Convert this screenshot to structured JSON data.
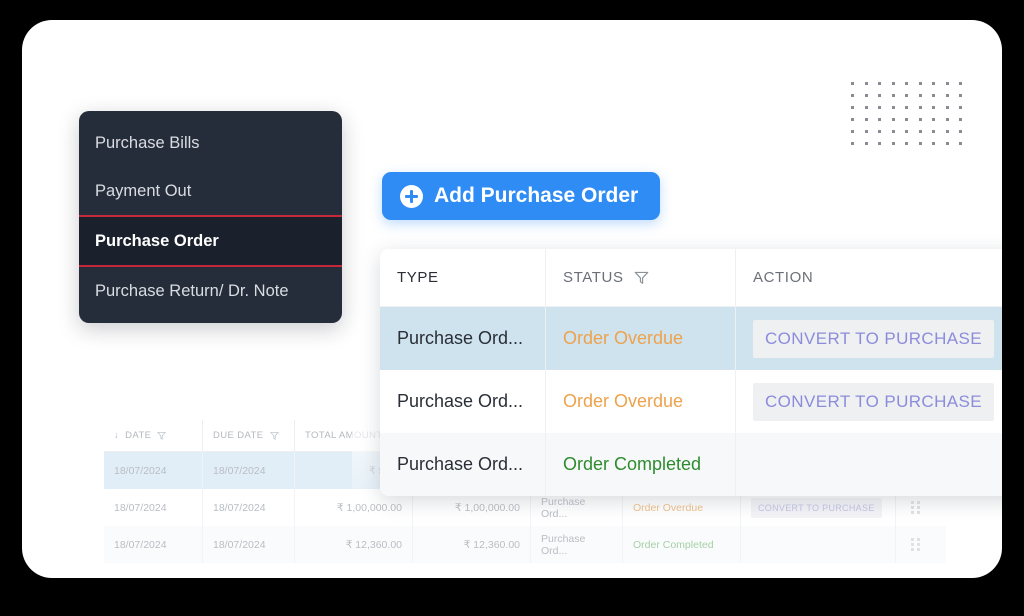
{
  "sidebar": {
    "items": [
      {
        "label": "Purchase Bills",
        "active": false
      },
      {
        "label": "Payment Out",
        "active": false
      },
      {
        "label": "Purchase Order",
        "active": true
      },
      {
        "label": "Purchase Return/ Dr. Note",
        "active": false
      }
    ]
  },
  "add_button": {
    "label": "Add Purchase Order",
    "icon": "plus-circle-icon",
    "color": "#2f8cf5"
  },
  "decoration": {
    "dot_grid": {
      "columns": 9,
      "rows": 6,
      "color": "#8b8b93"
    }
  },
  "zoom_panel": {
    "headers": [
      {
        "label": "TYPE",
        "filter": false
      },
      {
        "label": "STATUS",
        "filter": true,
        "filter_icon": "filter-funnel-icon"
      },
      {
        "label": "ACTION",
        "filter": false
      }
    ],
    "rows": [
      {
        "type": "Purchase Ord...",
        "status": "Order Overdue",
        "status_color": "#eda24c",
        "action": "CONVERT TO PURCHASE",
        "highlight": "selected"
      },
      {
        "type": "Purchase Ord...",
        "status": "Order Overdue",
        "status_color": "#eda24c",
        "action": "CONVERT TO PURCHASE",
        "highlight": "plain"
      },
      {
        "type": "Purchase Ord...",
        "status": "Order Completed",
        "status_color": "#2e8b2e",
        "action": "",
        "highlight": "alt"
      }
    ]
  },
  "background_table": {
    "headers": [
      {
        "label": "DATE",
        "sort": "descending",
        "sort_icon": "arrow-down-icon",
        "filter": true
      },
      {
        "label": "DUE DATE",
        "filter": true
      },
      {
        "label": "TOTAL AMOUNT",
        "filter": false
      },
      {
        "label": "",
        "filter": false
      },
      {
        "label": "",
        "filter": false
      },
      {
        "label": "",
        "filter": false
      },
      {
        "label": "",
        "filter": false
      },
      {
        "label": "",
        "filter": false
      }
    ],
    "rows": [
      {
        "date": "18/07/2024",
        "due_date": "18/07/2024",
        "total": "₹ 5,70,",
        "balance": "",
        "type": "",
        "status": "",
        "status_color": "",
        "action": "",
        "highlight": "selected"
      },
      {
        "date": "18/07/2024",
        "due_date": "18/07/2024",
        "total": "₹ 1,00,000.00",
        "balance": "₹ 1,00,000.00",
        "type": "Purchase Ord...",
        "status": "Order Overdue",
        "status_color": "#f0c08c",
        "action": "CONVERT TO PURCHASE",
        "highlight": "plain"
      },
      {
        "date": "18/07/2024",
        "due_date": "18/07/2024",
        "total": "₹ 12,360.00",
        "balance": "₹ 12,360.00",
        "type": "Purchase Ord...",
        "status": "Order Completed",
        "status_color": "#a6d0a6",
        "action": "",
        "highlight": "alt"
      }
    ],
    "row_grip_icon": "drag-handle-icon"
  },
  "theme": {
    "page_background": "#000000",
    "card_background": "#ffffff",
    "sidebar_background": "#262d3a",
    "sidebar_active_background": "#1b212c",
    "sidebar_active_border": "#c4283a",
    "accent_blue": "#2f8cf5",
    "row_selected_blue": "#cfe3ef",
    "status_overdue": "#eda24c",
    "status_completed": "#2e8b2e",
    "convert_link": "#8c8cdb"
  }
}
